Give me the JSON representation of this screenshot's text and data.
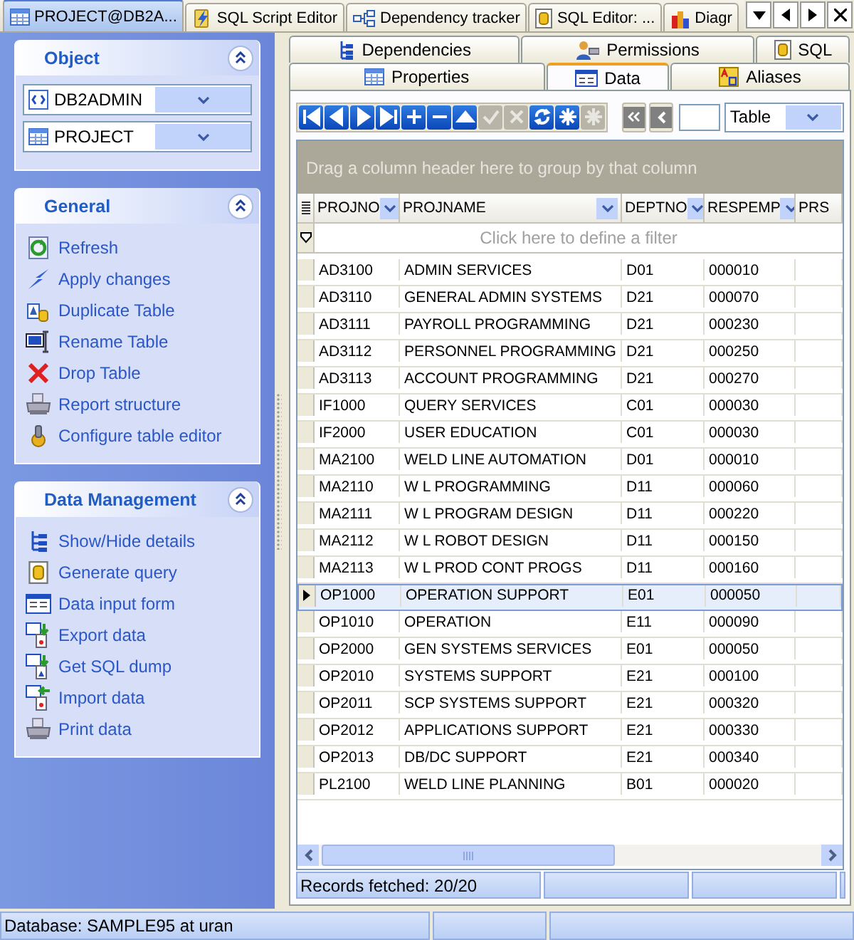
{
  "doc_tabs": [
    {
      "label": "PROJECT@DB2A...",
      "selected": true
    },
    {
      "label": "SQL Script Editor",
      "selected": false
    },
    {
      "label": "Dependency tracker",
      "selected": false
    },
    {
      "label": "SQL Editor: ...",
      "selected": false
    },
    {
      "label": "Diagr",
      "selected": false
    }
  ],
  "sidebar": {
    "panels": [
      {
        "title": "Object",
        "kind": "combos",
        "items": [
          {
            "value": "DB2ADMIN"
          },
          {
            "value": "PROJECT"
          }
        ]
      },
      {
        "title": "General",
        "kind": "links",
        "items": [
          {
            "label": "Refresh"
          },
          {
            "label": "Apply changes"
          },
          {
            "label": "Duplicate Table"
          },
          {
            "label": "Rename Table"
          },
          {
            "label": "Drop Table"
          },
          {
            "label": "Report structure"
          },
          {
            "label": "Configure table editor"
          }
        ]
      },
      {
        "title": "Data Management",
        "kind": "links",
        "items": [
          {
            "label": "Show/Hide details"
          },
          {
            "label": "Generate query"
          },
          {
            "label": "Data input form"
          },
          {
            "label": "Export data"
          },
          {
            "label": "Get SQL dump"
          },
          {
            "label": "Import data"
          },
          {
            "label": "Print data"
          }
        ]
      }
    ]
  },
  "sub_tabs": {
    "back_row": [
      {
        "label": "Dependencies",
        "selected": false
      },
      {
        "label": "Permissions",
        "selected": false
      },
      {
        "label": "SQL",
        "selected": false
      }
    ],
    "front_row": [
      {
        "label": "Properties",
        "selected": false
      },
      {
        "label": "Data",
        "selected": true
      },
      {
        "label": "Aliases",
        "selected": false
      }
    ]
  },
  "toolbar": {
    "buttons": [
      {
        "disabled": false
      },
      {
        "disabled": false
      },
      {
        "disabled": false
      },
      {
        "disabled": false
      },
      {
        "disabled": false
      },
      {
        "disabled": false
      },
      {
        "disabled": false
      },
      {
        "disabled": true
      },
      {
        "disabled": true
      },
      {
        "disabled": false
      },
      {
        "disabled": false
      },
      {
        "disabled": true
      }
    ],
    "view": {
      "value": "Table"
    }
  },
  "grid": {
    "group_hint": "Drag a column header here to group by that column",
    "columns": [
      "PROJNO",
      "PROJNAME",
      "DEPTNO",
      "RESPEMP",
      "PRS"
    ],
    "filter_hint": "Click here to define a filter",
    "rows": [
      {
        "cells": [
          "AD3100",
          "ADMIN SERVICES",
          "D01",
          "000010"
        ],
        "selected": false
      },
      {
        "cells": [
          "AD3110",
          "GENERAL ADMIN SYSTEMS",
          "D21",
          "000070"
        ],
        "selected": false
      },
      {
        "cells": [
          "AD3111",
          "PAYROLL PROGRAMMING",
          "D21",
          "000230"
        ],
        "selected": false
      },
      {
        "cells": [
          "AD3112",
          "PERSONNEL PROGRAMMING",
          "D21",
          "000250"
        ],
        "selected": false
      },
      {
        "cells": [
          "AD3113",
          "ACCOUNT PROGRAMMING",
          "D21",
          "000270"
        ],
        "selected": false
      },
      {
        "cells": [
          "IF1000",
          "QUERY SERVICES",
          "C01",
          "000030"
        ],
        "selected": false
      },
      {
        "cells": [
          "IF2000",
          "USER EDUCATION",
          "C01",
          "000030"
        ],
        "selected": false
      },
      {
        "cells": [
          "MA2100",
          "WELD LINE AUTOMATION",
          "D01",
          "000010"
        ],
        "selected": false
      },
      {
        "cells": [
          "MA2110",
          "W L PROGRAMMING",
          "D11",
          "000060"
        ],
        "selected": false
      },
      {
        "cells": [
          "MA2111",
          "W L PROGRAM DESIGN",
          "D11",
          "000220"
        ],
        "selected": false
      },
      {
        "cells": [
          "MA2112",
          "W L ROBOT DESIGN",
          "D11",
          "000150"
        ],
        "selected": false
      },
      {
        "cells": [
          "MA2113",
          "W L PROD CONT PROGS",
          "D11",
          "000160"
        ],
        "selected": false
      },
      {
        "cells": [
          "OP1000",
          "OPERATION SUPPORT",
          "E01",
          "000050"
        ],
        "selected": true
      },
      {
        "cells": [
          "OP1010",
          "OPERATION",
          "E11",
          "000090"
        ],
        "selected": false
      },
      {
        "cells": [
          "OP2000",
          "GEN SYSTEMS SERVICES",
          "E01",
          "000050"
        ],
        "selected": false
      },
      {
        "cells": [
          "OP2010",
          "SYSTEMS SUPPORT",
          "E21",
          "000100"
        ],
        "selected": false
      },
      {
        "cells": [
          "OP2011",
          "SCP SYSTEMS SUPPORT",
          "E21",
          "000320"
        ],
        "selected": false
      },
      {
        "cells": [
          "OP2012",
          "APPLICATIONS SUPPORT",
          "E21",
          "000330"
        ],
        "selected": false
      },
      {
        "cells": [
          "OP2013",
          "DB/DC SUPPORT",
          "E21",
          "000340"
        ],
        "selected": false
      },
      {
        "cells": [
          "PL2100",
          "WELD LINE PLANNING",
          "B01",
          "000020"
        ],
        "selected": false
      }
    ],
    "records": "Records fetched: 20/20"
  },
  "status_bar": "Database: SAMPLE95 at uran"
}
